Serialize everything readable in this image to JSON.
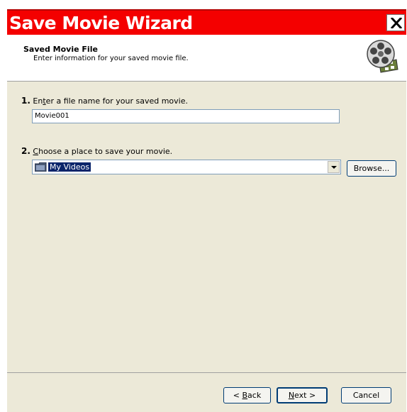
{
  "window": {
    "title": "Save Movie Wizard",
    "close_icon": "close-x-icon"
  },
  "header": {
    "title": "Saved Movie File",
    "subtitle": "Enter information for your saved movie file.",
    "icon": "film-reel-icon"
  },
  "step1": {
    "number": "1.",
    "label_pre": "En",
    "label_accel": "t",
    "label_post": "er a file name for your saved movie.",
    "filename_value": "Movie001"
  },
  "step2": {
    "number": "2.",
    "label_accel": "C",
    "label_post": "hoose a place to save your movie.",
    "location_value": "My Videos",
    "location_icon": "folder-icon",
    "browse_label": "Browse..."
  },
  "footer": {
    "back_arrow": "< ",
    "back_accel": "B",
    "back_rest": "ack",
    "next_accel": "N",
    "next_rest": "ext >",
    "cancel_label": "Cancel"
  },
  "colors": {
    "titlebar": "#f40000",
    "dialog_bg": "#ece9d8",
    "selection": "#0a246a"
  }
}
